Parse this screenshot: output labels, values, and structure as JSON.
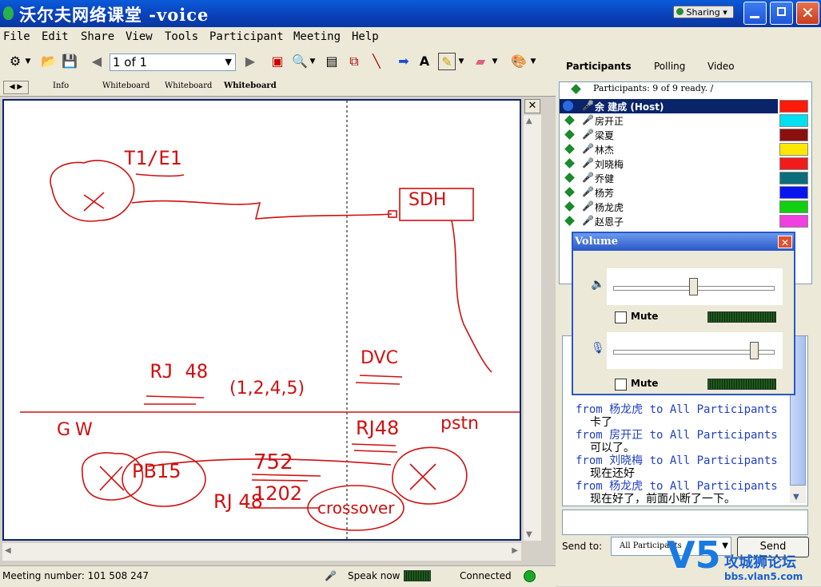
{
  "window": {
    "title": "沃尔夫网络课堂 -voice",
    "sharing_label": "Sharing"
  },
  "menu": [
    "File",
    "Edit",
    "Share",
    "View",
    "Tools",
    "Participant",
    "Meeting",
    "Help"
  ],
  "toolbar": {
    "page_indicator": "1 of 1"
  },
  "doc_tabs": [
    "Info",
    "Whiteboard",
    "Whiteboard",
    "Whiteboard"
  ],
  "whiteboard": {
    "labels": [
      "T1/E1",
      "SDH",
      "RJ 48",
      "(1,2,4,5)",
      "DVC",
      "RJ48",
      "PB15",
      "752",
      "1202",
      "GW",
      "pstn",
      "RJ 48",
      "crossover"
    ]
  },
  "status": {
    "meeting_number": "Meeting number: 101 508 247",
    "speak_now": "Speak now",
    "connected": "Connected"
  },
  "right_tabs": [
    "Participants",
    "Polling",
    "Video"
  ],
  "participants": {
    "header": "Participants: 9 of 9 ready. /",
    "list": [
      {
        "name": "余 建成 (Host)",
        "color": "#ff1a0a"
      },
      {
        "name": "房开正",
        "color": "#00e0f0"
      },
      {
        "name": "梁夏",
        "color": "#8a1010"
      },
      {
        "name": "林杰",
        "color": "#ffe800"
      },
      {
        "name": "刘晓梅",
        "color": "#f01c1c"
      },
      {
        "name": "乔健",
        "color": "#0a6e7a"
      },
      {
        "name": "杨芳",
        "color": "#0814f0"
      },
      {
        "name": "杨龙虎",
        "color": "#10d010"
      },
      {
        "name": "赵恩子",
        "color": "#f040e0"
      }
    ]
  },
  "volume": {
    "title": "Volume",
    "mute_label_1": "Mute",
    "mute_label_2": "Mute",
    "speaker_level": 0.5,
    "mic_level": 0.88
  },
  "chat": {
    "messages": [
      {
        "from": "from 杨龙虎 to All Participants",
        "text": "卡了"
      },
      {
        "from": "from 房开正 to All Participants",
        "text": "可以了。"
      },
      {
        "from": "from 刘晓梅 to All Participants",
        "text": "现在还好"
      },
      {
        "from": "from 杨龙虎 to All Participants",
        "text": "现在好了，前面小断了一下。"
      }
    ],
    "send_to_label": "Send to:",
    "send_to_value": "All Participants",
    "send_label": "Send"
  },
  "watermark": {
    "name": "攻城狮论坛",
    "url": "bbs.vlan5.com"
  }
}
